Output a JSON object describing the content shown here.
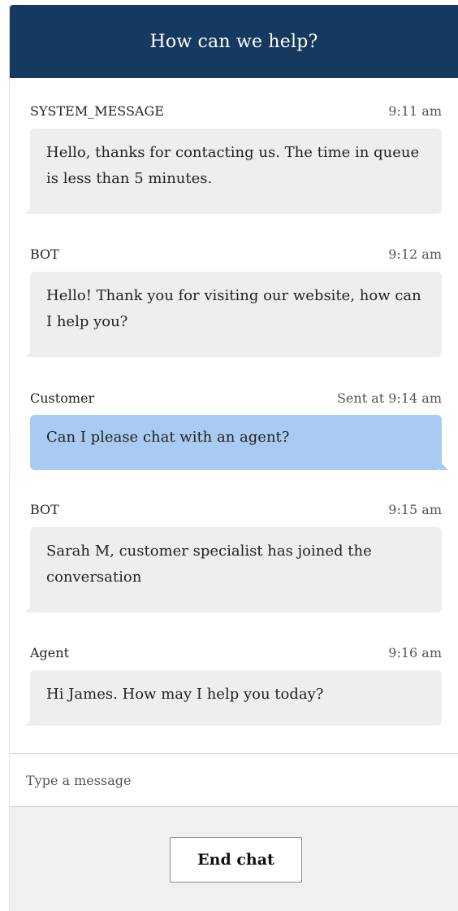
{
  "header": {
    "title": "How can we help?"
  },
  "messages": [
    {
      "sender": "SYSTEM_MESSAGE",
      "time": "9:11 am",
      "text": "Hello, thanks for contacting us. The time in queue is less than 5 minutes.",
      "kind": "incoming"
    },
    {
      "sender": "BOT",
      "time": "9:12 am",
      "text": "Hello! Thank you for visiting our website, how can I help you?",
      "kind": "incoming"
    },
    {
      "sender": "Customer",
      "time": "Sent at 9:14 am",
      "text": "Can I please chat with an agent?",
      "kind": "outgoing"
    },
    {
      "sender": "BOT",
      "time": "9:15 am",
      "text": "Sarah M, customer specialist has joined the conversation",
      "kind": "incoming"
    },
    {
      "sender": "Agent",
      "time": "9:16 am",
      "text": "Hi James. How may I help you today?",
      "kind": "incoming"
    }
  ],
  "composer": {
    "placeholder": "Type a message",
    "value": ""
  },
  "footer": {
    "end_chat_label": "End chat"
  },
  "colors": {
    "header_bg": "#163a5f",
    "incoming_bubble": "#eeeeee",
    "outgoing_bubble": "#a9cbf2",
    "footer_bg": "#f0f0f0"
  }
}
